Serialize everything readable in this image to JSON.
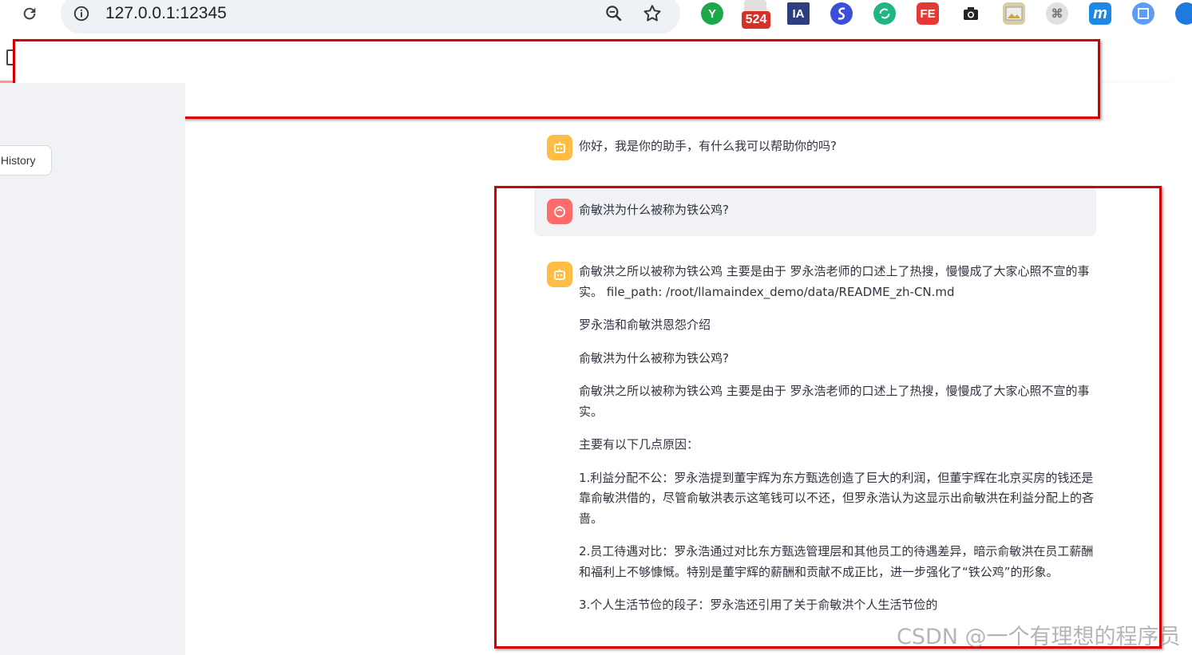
{
  "browser": {
    "url": "127.0.0.1:12345",
    "extension_badge": "524",
    "extensions": [
      {
        "name": "yuque-icon",
        "label": "Y",
        "color": "#1aa84a"
      },
      {
        "name": "ia-icon",
        "label": "IA",
        "color": "#2c3e80"
      },
      {
        "name": "s-logo-icon",
        "label": "",
        "color": "#3b4fd8"
      },
      {
        "name": "sync-icon",
        "label": "",
        "color": "#21b585"
      },
      {
        "name": "fe-icon",
        "label": "FE",
        "color": "#e53935"
      },
      {
        "name": "camera-icon",
        "label": "",
        "color": "#222222"
      },
      {
        "name": "image-icon",
        "label": "",
        "color": "#c9a640"
      },
      {
        "name": "command-icon",
        "label": "⌘",
        "color": "#9e9e9e"
      },
      {
        "name": "m-icon",
        "label": "m",
        "color": "#1e88e5"
      },
      {
        "name": "screenshot-icon",
        "label": "",
        "color": "#5c9df5"
      },
      {
        "name": "edge-icon",
        "label": "",
        "color": "#1f7ae0"
      }
    ]
  },
  "sidebar": {
    "history_button": "History"
  },
  "chat": {
    "greeting": "你好，我是你的助手，有什么我可以帮助你的吗?",
    "user_question": "俞敏洪为什么被称为铁公鸡?",
    "response_paragraphs": [
      "俞敏洪之所以被称为铁公鸡 主要是由于 罗永浩老师的口述上了热搜，慢慢成了大家心照不宣的事实。 file_path: /root/llamaindex_demo/data/README_zh-CN.md",
      "罗永浩和俞敏洪恩怨介绍",
      "俞敏洪为什么被称为铁公鸡?",
      "俞敏洪之所以被称为铁公鸡 主要是由于 罗永浩老师的口述上了热搜，慢慢成了大家心照不宣的事实。",
      "主要有以下几点原因：",
      "1.利益分配不公：罗永浩提到董宇辉为东方甄选创造了巨大的利润，但董宇辉在北京买房的钱还是靠俞敏洪借的，尽管俞敏洪表示这笔钱可以不还，但罗永浩认为这显示出俞敏洪在利益分配上的吝啬。",
      "2.员工待遇对比：罗永浩通过对比东方甄选管理层和其他员工的待遇差异，暗示俞敏洪在员工薪酬和福利上不够慷慨。特别是董宇辉的薪酬和贡献不成正比，进一步强化了“铁公鸡”的形象。",
      "3.个人生活节俭的段子：罗永浩还引用了关于俞敏洪个人生活节俭的"
    ]
  },
  "watermark": "CSDN @一个有理想的程序员",
  "colors": {
    "annotation_red": "#d40000",
    "bot_avatar": "#ffbd45",
    "user_avatar": "#ff6b6b",
    "sidebar_bg": "#f0f2f6"
  }
}
